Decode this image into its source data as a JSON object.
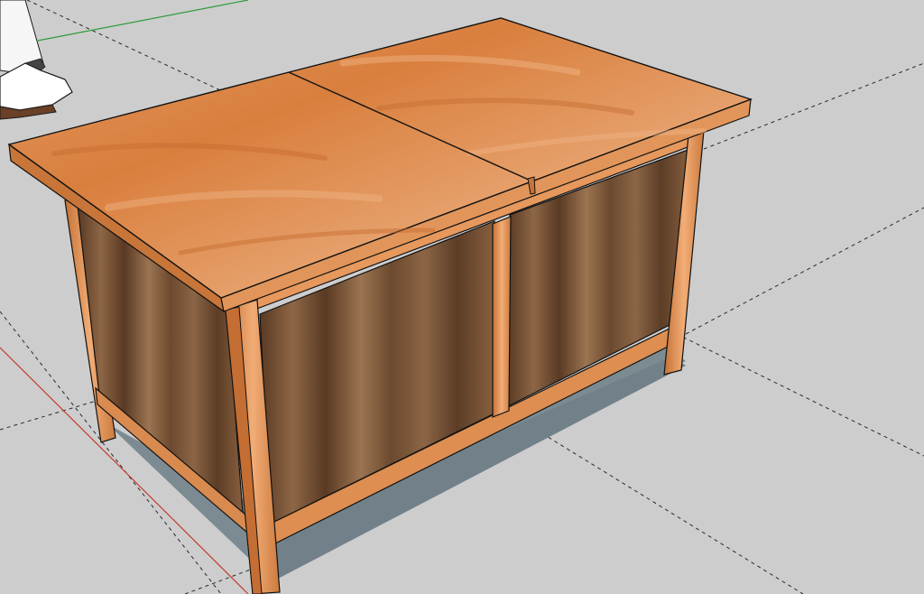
{
  "app": {
    "viewport_name": "3d-model-viewport"
  },
  "scene": {
    "background": "#cdcdcd",
    "ground_grid": "#262626",
    "axis_red": "#c23b2e",
    "axis_green": "#2e9b3a",
    "shadow": "#7c8a92",
    "wood_top_light": "#e29455",
    "wood_top_dark": "#b86a34",
    "wood_frame_light": "#eba16a",
    "wood_frame_dark": "#b7672f",
    "panel_light": "#8d6645",
    "panel_dark": "#4f321f",
    "edge": "#121212",
    "figure_skin": "#ffffff",
    "figure_shoe": "#6a4126"
  },
  "icons": {
    "figure": "scale-figure-icon"
  }
}
